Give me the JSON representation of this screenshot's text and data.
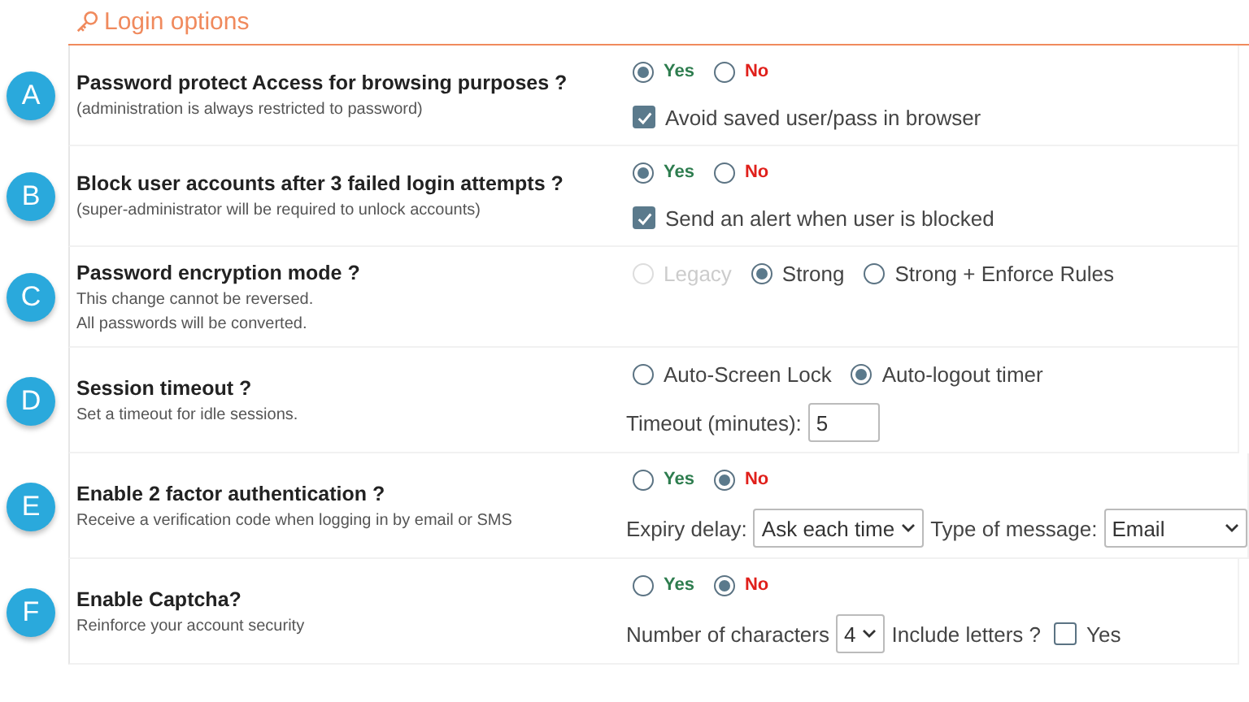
{
  "header": {
    "title": "Login options"
  },
  "sections": [
    {
      "badge": "A",
      "title": "Password protect Access for browsing purposes ?",
      "notes": [
        "(administration is always restricted to password)"
      ],
      "lines": [
        [
          {
            "kind": "radio",
            "label": "Yes",
            "selected": true,
            "color": "#2e7d4f"
          },
          {
            "kind": "radio",
            "label": "No",
            "selected": false,
            "color": "#e0201b"
          }
        ],
        [
          {
            "kind": "checkbox",
            "label": "Avoid saved user/pass in browser",
            "checked": true
          }
        ]
      ]
    },
    {
      "badge": "B",
      "title": "Block user accounts after 3 failed login attempts ?",
      "notes": [
        "(super-administrator will be required to unlock accounts)"
      ],
      "lines": [
        [
          {
            "kind": "radio",
            "label": "Yes",
            "selected": true,
            "color": "#2e7d4f"
          },
          {
            "kind": "radio",
            "label": "No",
            "selected": false,
            "color": "#e0201b"
          }
        ],
        [
          {
            "kind": "checkbox",
            "label": "Send an alert when user is blocked",
            "checked": true
          }
        ]
      ]
    },
    {
      "badge": "C",
      "title": "Password encryption mode ?",
      "notes": [
        "This change cannot be reversed.",
        "All passwords will be converted."
      ],
      "lines": [
        [
          {
            "kind": "radio",
            "label": "Legacy",
            "selected": false,
            "disabled": true
          },
          {
            "kind": "radio",
            "label": "Strong",
            "selected": true,
            "disabled": false
          },
          {
            "kind": "radio",
            "label": "Strong + Enforce Rules",
            "selected": false,
            "disabled": false
          }
        ]
      ]
    },
    {
      "badge": "D",
      "title": "Session timeout ?",
      "notes": [
        "Set a timeout for idle sessions."
      ],
      "lines": [
        [
          {
            "kind": "radio",
            "label": "Auto-Screen Lock",
            "selected": false
          },
          {
            "kind": "radio",
            "label": "Auto-logout timer",
            "selected": true
          }
        ],
        [
          {
            "kind": "label",
            "text": "Timeout (minutes):"
          },
          {
            "kind": "input",
            "value": "5"
          }
        ]
      ]
    },
    {
      "badge": "E",
      "title": "Enable 2 factor authentication ?",
      "notes": [
        "Receive a verification code when logging in by email or SMS"
      ],
      "lines": [
        [
          {
            "kind": "radio",
            "label": "Yes",
            "selected": false,
            "color": "#2e7d4f"
          },
          {
            "kind": "radio",
            "label": "No",
            "selected": true,
            "color": "#e0201b"
          }
        ],
        [
          {
            "kind": "label",
            "text": "Expiry delay:"
          },
          {
            "kind": "select",
            "value": "Ask each time"
          },
          {
            "kind": "label",
            "text": "Type of message:"
          },
          {
            "kind": "select",
            "value": "Email"
          }
        ]
      ]
    },
    {
      "badge": "F",
      "title": "Enable Captcha?",
      "notes": [
        "Reinforce your account security"
      ],
      "lines": [
        [
          {
            "kind": "radio",
            "label": "Yes",
            "selected": false,
            "color": "#2e7d4f"
          },
          {
            "kind": "radio",
            "label": "No",
            "selected": true,
            "color": "#e0201b"
          }
        ],
        [
          {
            "kind": "label",
            "text": "Number of characters"
          },
          {
            "kind": "select",
            "value": "4"
          },
          {
            "kind": "label",
            "text": "Include letters ?"
          },
          {
            "kind": "checkbox",
            "label": "Yes",
            "checked": false
          }
        ]
      ]
    }
  ]
}
